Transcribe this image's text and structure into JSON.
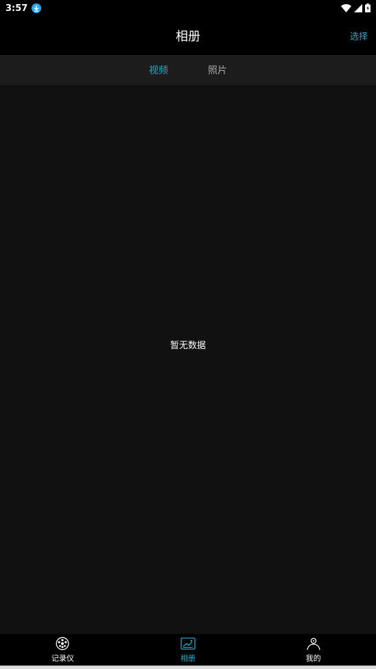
{
  "status_bar": {
    "time": "3:57",
    "icons": [
      "download-icon",
      "wifi-icon",
      "signal-icon",
      "battery-icon"
    ]
  },
  "app_bar": {
    "title": "相册",
    "select_label": "选择"
  },
  "tabs": [
    {
      "label": "视频",
      "active": true
    },
    {
      "label": "照片",
      "active": false
    }
  ],
  "content": {
    "empty_text": "暂无数据"
  },
  "bottom_nav": {
    "items": [
      {
        "label": "记录仪",
        "icon": "dashcam-icon",
        "active": false
      },
      {
        "label": "相册",
        "icon": "album-icon",
        "active": true
      },
      {
        "label": "我的",
        "icon": "profile-icon",
        "active": false
      }
    ]
  },
  "colors": {
    "accent": "#2aa7c9",
    "background": "#000000",
    "content_bg": "#111111",
    "tab_bar_bg": "#1c1c1c",
    "inactive_tab": "#a6a6a6"
  }
}
